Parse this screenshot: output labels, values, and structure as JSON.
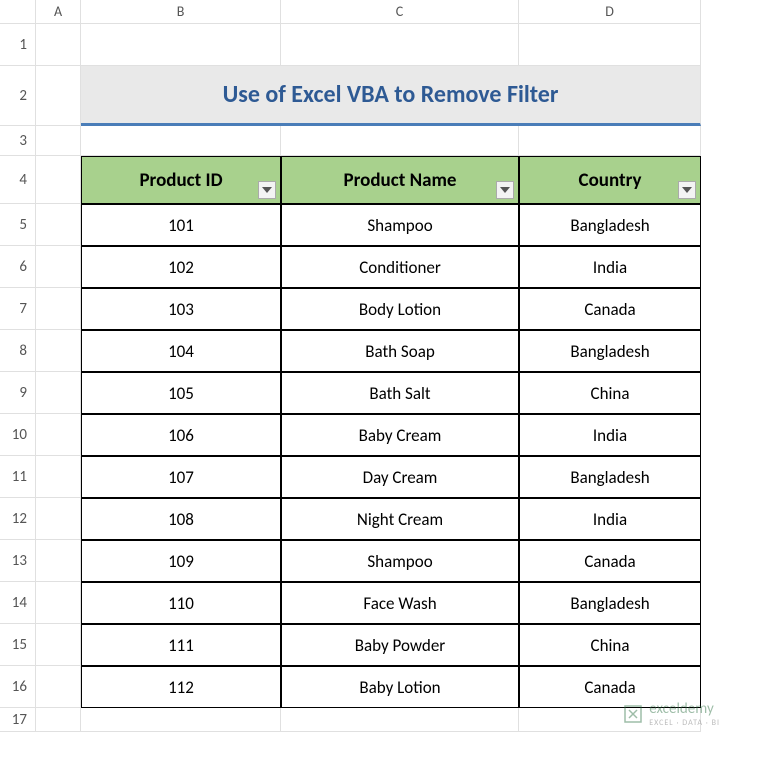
{
  "columns": [
    "A",
    "B",
    "C",
    "D"
  ],
  "row_numbers": [
    "1",
    "2",
    "3",
    "4",
    "5",
    "6",
    "7",
    "8",
    "9",
    "10",
    "11",
    "12",
    "13",
    "14",
    "15",
    "16",
    "17"
  ],
  "title": "Use of Excel VBA to Remove Filter",
  "headers": [
    "Product ID",
    "Product Name",
    "Country"
  ],
  "rows": [
    {
      "id": "101",
      "name": "Shampoo",
      "country": "Bangladesh"
    },
    {
      "id": "102",
      "name": "Conditioner",
      "country": "India"
    },
    {
      "id": "103",
      "name": "Body Lotion",
      "country": "Canada"
    },
    {
      "id": "104",
      "name": "Bath Soap",
      "country": "Bangladesh"
    },
    {
      "id": "105",
      "name": "Bath Salt",
      "country": "China"
    },
    {
      "id": "106",
      "name": "Baby Cream",
      "country": "India"
    },
    {
      "id": "107",
      "name": "Day Cream",
      "country": "Bangladesh"
    },
    {
      "id": "108",
      "name": "Night Cream",
      "country": "India"
    },
    {
      "id": "109",
      "name": "Shampoo",
      "country": "Canada"
    },
    {
      "id": "110",
      "name": "Face Wash",
      "country": "Bangladesh"
    },
    {
      "id": "111",
      "name": "Baby Powder",
      "country": "China"
    },
    {
      "id": "112",
      "name": "Baby Lotion",
      "country": "Canada"
    }
  ],
  "watermark": {
    "brand": "exceldemy",
    "sub": "EXCEL · DATA · BI"
  },
  "chart_data": {
    "type": "table",
    "title": "Use of Excel VBA to Remove Filter",
    "columns": [
      "Product ID",
      "Product Name",
      "Country"
    ],
    "data": [
      [
        101,
        "Shampoo",
        "Bangladesh"
      ],
      [
        102,
        "Conditioner",
        "India"
      ],
      [
        103,
        "Body Lotion",
        "Canada"
      ],
      [
        104,
        "Bath Soap",
        "Bangladesh"
      ],
      [
        105,
        "Bath Salt",
        "China"
      ],
      [
        106,
        "Baby Cream",
        "India"
      ],
      [
        107,
        "Day Cream",
        "Bangladesh"
      ],
      [
        108,
        "Night Cream",
        "India"
      ],
      [
        109,
        "Shampoo",
        "Canada"
      ],
      [
        110,
        "Face Wash",
        "Bangladesh"
      ],
      [
        111,
        "Baby Powder",
        "China"
      ],
      [
        112,
        "Baby Lotion",
        "Canada"
      ]
    ]
  }
}
